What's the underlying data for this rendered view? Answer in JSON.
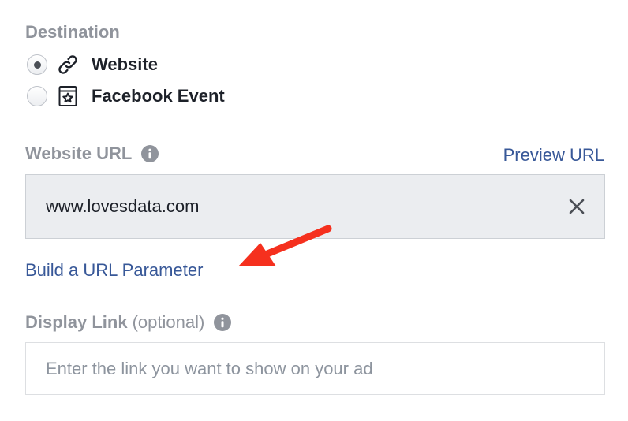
{
  "destination": {
    "title": "Destination",
    "options": [
      {
        "label": "Website",
        "icon": "link-icon",
        "selected": true
      },
      {
        "label": "Facebook Event",
        "icon": "event-star-icon",
        "selected": false
      }
    ]
  },
  "website_url": {
    "label": "Website URL",
    "info_icon": "info-icon",
    "preview_link": "Preview URL",
    "value": "www.lovesdata.com",
    "clear_icon": "close-icon"
  },
  "build_param_link": "Build a URL Parameter",
  "annotation": {
    "icon": "red-arrow-annotation",
    "color": "#f5301e"
  },
  "display_link": {
    "label": "Display Link",
    "optional": "(optional)",
    "info_icon": "info-icon",
    "placeholder": "Enter the link you want to show on your ad",
    "value": ""
  },
  "colors": {
    "label_gray": "#90949c",
    "link_blue": "#385898",
    "text_dark": "#1d2129",
    "field_bg": "#ebedf0"
  }
}
